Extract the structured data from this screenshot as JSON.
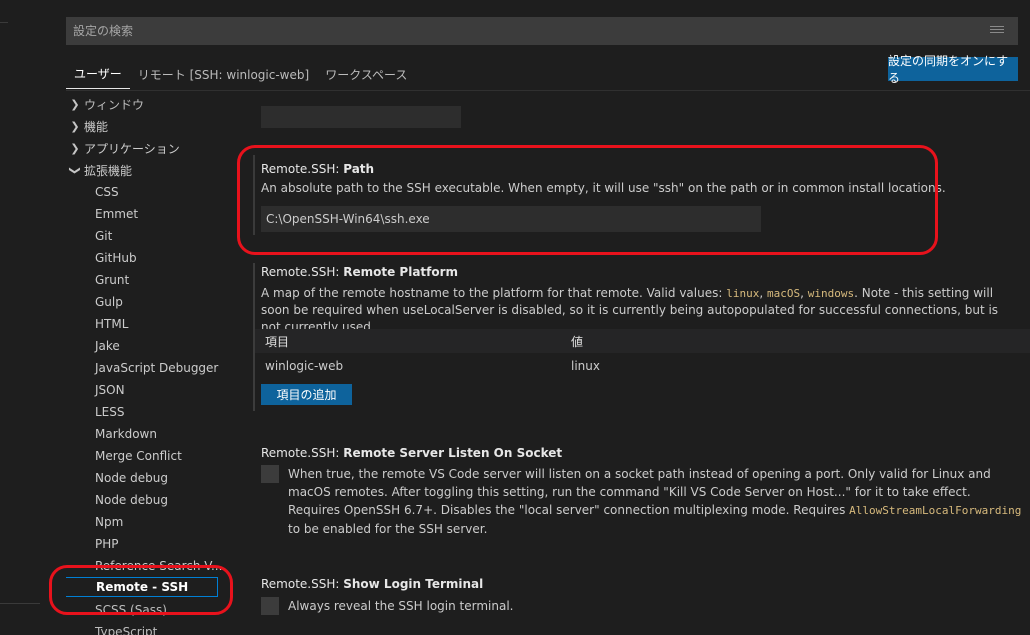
{
  "search": {
    "placeholder": "設定の検索"
  },
  "tabs": [
    {
      "label": "ユーザー",
      "active": true
    },
    {
      "label": "リモート [SSH: winlogic-web]"
    },
    {
      "label": "ワークスペース"
    }
  ],
  "sync_button": "設定の同期をオンにする",
  "tree": {
    "top_clipped": "ウィンドウ",
    "items": [
      {
        "label": "機能",
        "expanded": false
      },
      {
        "label": "アプリケーション",
        "expanded": false
      },
      {
        "label": "拡張機能",
        "expanded": true
      }
    ],
    "children": [
      "CSS",
      "Emmet",
      "Git",
      "GitHub",
      "Grunt",
      "Gulp",
      "HTML",
      "Jake",
      "JavaScript Debugger",
      "JSON",
      "LESS",
      "Markdown",
      "Merge Conflict",
      "Node debug",
      "Node debug",
      "Npm",
      "PHP",
      "Reference Search V..."
    ],
    "selected": "Remote - SSH",
    "after_selected": [
      "SCSS (Sass)",
      "TypeScript"
    ]
  },
  "settings": {
    "path": {
      "category": "Remote.SSH: ",
      "key": "Path",
      "description": "An absolute path to the SSH executable. When empty, it will use \"ssh\" on the path or in common install locations.",
      "value": "C:\\OpenSSH-Win64\\ssh.exe"
    },
    "platform": {
      "category": "Remote.SSH: ",
      "key": "Remote Platform",
      "desc_a": "A map of the remote hostname to the platform for that remote. Valid values: ",
      "v1": "linux",
      "sep1": ", ",
      "v2": "macOS",
      "sep2": ", ",
      "v3": "windows",
      "desc_b": ". Note - this setting will soon be required when useLocalServer is disabled, so it is currently being autopopulated for successful connections, but is not currently used.",
      "table": {
        "col_key": "項目",
        "col_value": "値",
        "rows": [
          {
            "key": "winlogic-web",
            "value": "linux"
          }
        ]
      },
      "add_button": "項目の追加"
    },
    "listen": {
      "category": "Remote.SSH: ",
      "key": "Remote Server Listen On Socket",
      "desc_a": "When true, the remote VS Code server will listen on a socket path instead of opening a port. Only valid for Linux and macOS remotes. After toggling this setting, run the command \"Kill VS Code Server on Host...\" for it to take effect. Requires OpenSSH 6.7+. Disables the \"local server\" connection multiplexing mode. Requires ",
      "code": "AllowStreamLocalForwarding",
      "desc_b": " to be enabled for the SSH server.",
      "checked": false
    },
    "terminal": {
      "category": "Remote.SSH: ",
      "key": "Show Login Terminal",
      "description": "Always reveal the SSH login terminal.",
      "checked": false
    }
  },
  "colors": {
    "accent": "#0e639c",
    "highlight": "#e8121c",
    "background": "#1e1e1e"
  },
  "icons": {
    "filter": "filter-list-icon",
    "chevron_right": "chevron-right-icon",
    "chevron_down": "chevron-down-icon"
  }
}
